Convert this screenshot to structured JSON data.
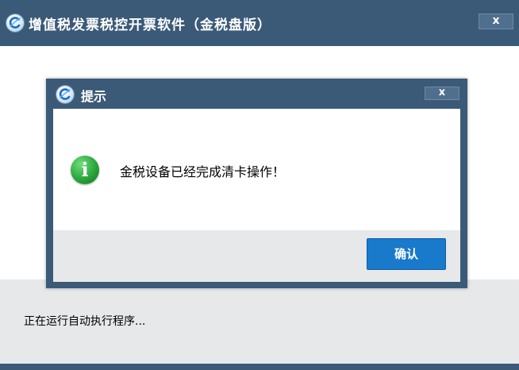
{
  "main_window": {
    "title": "增值税发票税控开票软件（金税盘版）",
    "close_label": "x",
    "status_text": "正在运行自动执行程序..."
  },
  "dialog": {
    "title": "提示",
    "close_label": "x",
    "info_icon_glyph": "i",
    "message": "金税设备已经完成清卡操作！",
    "ok_label": "确认"
  },
  "colors": {
    "titlebar": "#3b5a78",
    "accent_button": "#1979ca",
    "footer_gray": "#e6e8ea",
    "info_green": "#2aa53b"
  },
  "icons": {
    "app_logo": "app-logo-icon",
    "close": "close-icon",
    "info": "info-icon"
  }
}
